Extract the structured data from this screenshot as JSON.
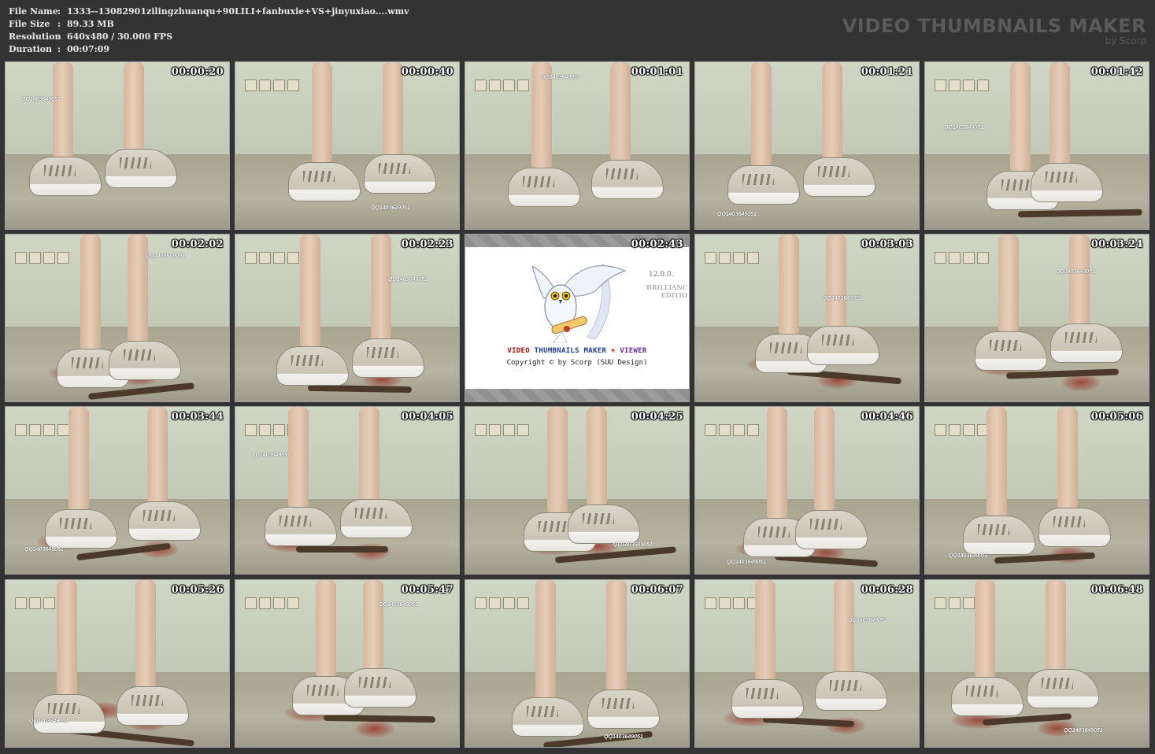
{
  "info": {
    "rows": [
      {
        "label": "File Name",
        "sep": ":",
        "value": "1333--13082901zilingzhuanqu+90LILI+fanbuxie+VS+jinyuxiao....wmv"
      },
      {
        "label": "File Size",
        "sep": ":",
        "value": "89.33 MB"
      },
      {
        "label": "Resolution",
        "sep": ":",
        "value": "640x480 / 30.000 FPS"
      },
      {
        "label": "Duration",
        "sep": ":",
        "value": "00:07:09"
      }
    ]
  },
  "brand": {
    "title": "VIDEO THUMBNAILS MAKER",
    "subtitle": "by Scorp",
    "color": "#5a5a5a"
  },
  "thumbnails": [
    {
      "time": "00:00:20",
      "watermark": "QQ1403649051"
    },
    {
      "time": "00:00:40",
      "watermark": "QQ1403649051"
    },
    {
      "time": "00:01:01",
      "watermark": "QQ1403649051"
    },
    {
      "time": "00:01:21",
      "watermark": "QQ1403649051"
    },
    {
      "time": "00:01:42",
      "watermark": "QQ1403649051"
    },
    {
      "time": "00:02:02",
      "watermark": "QQ1403649051"
    },
    {
      "time": "00:02:23",
      "watermark": "QQ1403649051"
    },
    {
      "time": "00:02:43",
      "watermark": ""
    },
    {
      "time": "00:03:03",
      "watermark": "QQ1403649051"
    },
    {
      "time": "00:03:24",
      "watermark": "QQ1403649051"
    },
    {
      "time": "00:03:44",
      "watermark": "QQ1403649051"
    },
    {
      "time": "00:04:05",
      "watermark": "QQ1403649051"
    },
    {
      "time": "00:04:25",
      "watermark": "QQ1403649051"
    },
    {
      "time": "00:04:46",
      "watermark": "QQ1403649051"
    },
    {
      "time": "00:05:06",
      "watermark": "QQ1403649051"
    },
    {
      "time": "00:05:26",
      "watermark": "QQ1403649051"
    },
    {
      "time": "00:05:47",
      "watermark": "QQ1403649051"
    },
    {
      "time": "00:06:07",
      "watermark": "QQ1403649051"
    },
    {
      "time": "00:06:28",
      "watermark": "QQ1403649051"
    },
    {
      "time": "00:06:48",
      "watermark": "QQ1403649051"
    }
  ],
  "splash": {
    "version": "12.0.0.",
    "edition_line1": "BRILLIANC",
    "edition_line2": "EDITIO",
    "title_part1": "VIDEO ",
    "title_part2": "THUMBNAILS MAKER",
    "title_part3": " + ",
    "title_part4": "VIEWER",
    "copyright": "Copyright © by Scorp (SUU Design)",
    "colors": {
      "video": "#b01010",
      "thumbs": "#1a3aa0",
      "plus": "#b01010",
      "viewer": "#6a2aa0"
    }
  }
}
